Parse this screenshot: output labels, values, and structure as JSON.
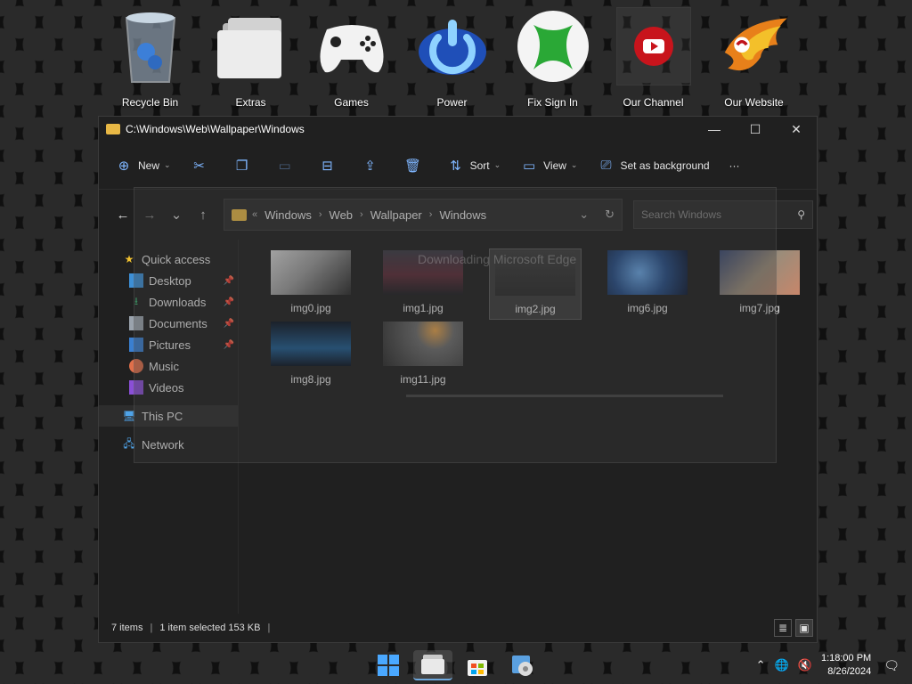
{
  "desktop": {
    "icons": [
      {
        "label": "Recycle Bin",
        "icon": "recycle-bin-icon"
      },
      {
        "label": "Extras",
        "icon": "folder-stack-icon"
      },
      {
        "label": "Games",
        "icon": "gamepad-icon"
      },
      {
        "label": "Power",
        "icon": "power-icon"
      },
      {
        "label": "Fix Sign In",
        "icon": "xbox-icon"
      },
      {
        "label": "Our Channel",
        "icon": "youtube-icon"
      },
      {
        "label": "Our Website",
        "icon": "phoenix-logo-icon"
      }
    ]
  },
  "window": {
    "title": "C:\\Windows\\Web\\Wallpaper\\Windows",
    "controls": {
      "minimize": "—",
      "maximize": "☐",
      "close": "✕"
    }
  },
  "toolbar": {
    "new_label": "New",
    "sort_label": "Sort",
    "view_label": "View",
    "set_background_label": "Set as background",
    "more_label": "···"
  },
  "address": {
    "overflow": "«",
    "crumbs": [
      "Windows",
      "Web",
      "Wallpaper",
      "Windows"
    ],
    "separator": "›"
  },
  "search": {
    "placeholder": "Search Windows"
  },
  "nav": {
    "quick_access": "Quick access",
    "items": [
      {
        "label": "Desktop",
        "pinned": true
      },
      {
        "label": "Downloads",
        "pinned": true
      },
      {
        "label": "Documents",
        "pinned": true
      },
      {
        "label": "Pictures",
        "pinned": true
      },
      {
        "label": "Music",
        "pinned": false
      },
      {
        "label": "Videos",
        "pinned": false
      }
    ],
    "this_pc": "This PC",
    "network": "Network"
  },
  "files": [
    {
      "name": "img0.jpg",
      "selected": false
    },
    {
      "name": "img1.jpg",
      "selected": false
    },
    {
      "name": "img2.jpg",
      "selected": true
    },
    {
      "name": "img6.jpg",
      "selected": false
    },
    {
      "name": "img7.jpg",
      "selected": false
    },
    {
      "name": "img8.jpg",
      "selected": false
    },
    {
      "name": "img11.jpg",
      "selected": false
    }
  ],
  "status": {
    "count": "7 items",
    "selection": "1 item selected  153 KB"
  },
  "overlay": {
    "text": "Downloading Microsoft Edge"
  },
  "taskbar": {
    "apps": [
      "start-icon",
      "file-explorer-icon",
      "store-icon",
      "control-panel-icon"
    ],
    "time": "1:18:00 PM",
    "date": "8/26/2024"
  },
  "colors": {
    "accent": "#7fb6ff",
    "folder": "#e8b845",
    "window_bg": "#202020"
  }
}
